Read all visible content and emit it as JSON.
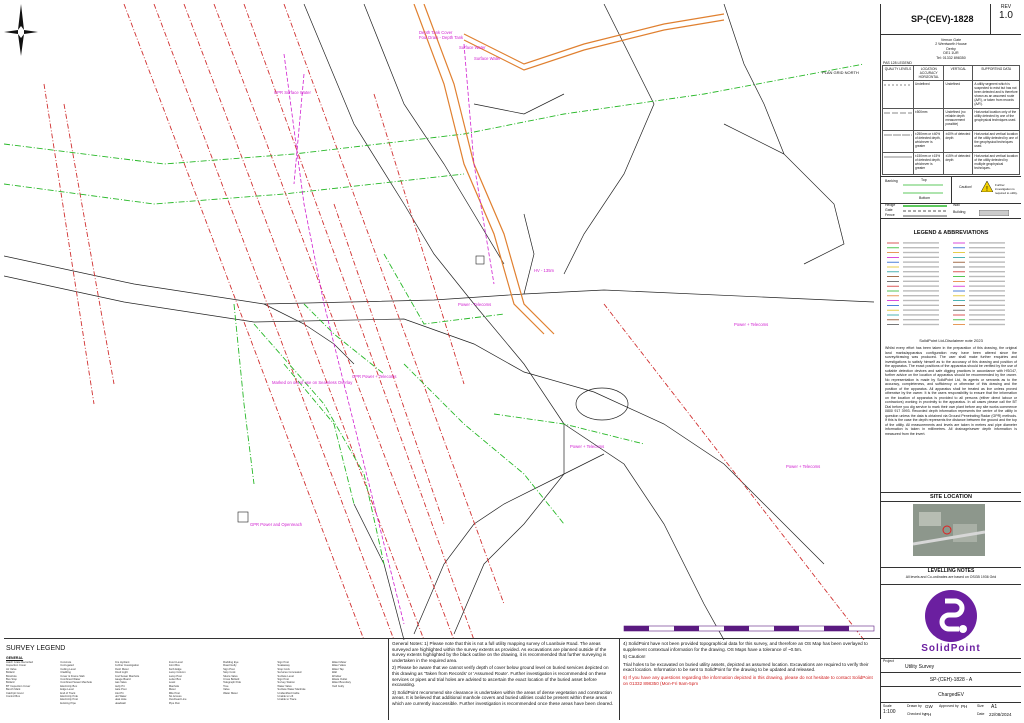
{
  "title_block": {
    "drawing_number": "SP-(CEV)-1828",
    "revision_label": "REV",
    "revision": "1.0",
    "address": [
      "Vernon Gate",
      "2 Wentworth House",
      "Derby",
      "DE1 1UR",
      "Tel: 01332 898350"
    ],
    "pas_title": "PAS 128 LEGEND",
    "quality_table": {
      "headers": [
        "QUALITY LEVELS",
        "LOCATION ACCURACY HORIZONTAL",
        "VERTICAL",
        "SUPPORTING DATA"
      ],
      "rows": [
        [
          "",
          "Undefined",
          "Undefined",
          "A utility segment which is suspected to exist but has not been detected and is therefore shown as an assumed route (A/R), or taken from records (A/R)."
        ],
        [
          "",
          "±500mm",
          "Undefined (no reliable depth measurement possible)",
          "Horizontal location only of the utility detected by one of the geophysical techniques used."
        ],
        [
          "",
          "±250mm or ±40% of detected depth, whichever is greater",
          "±40% of detected depth",
          "Horizontal and vertical location of the utility detected by one of the geophysical techniques used."
        ],
        [
          "",
          "±150mm or ±15% of detected depth, whichever is greater",
          "±15% of detected depth",
          "Horizontal and vertical location of the utility detected by multiple geophysical techniques."
        ]
      ]
    },
    "banking": {
      "label": "Banking",
      "top": "Top",
      "bottom": "Bottom",
      "caution": "Caution!",
      "caution_text": "Further investigation is required to utility."
    },
    "hedge": {
      "hedge": "Hedge",
      "wall": "Wall",
      "gate": "Gate",
      "building": "Building",
      "fence": "Fence"
    },
    "legend_title": "LEGEND & ABBREVIATIONS",
    "disclaimer_title": "SolidPoint Ltd-Disclaimer note 2023",
    "disclaimer": "Whilst every effort has been taken in the preparation of this drawing, the original land marks/apparatus configuration may have been altered since the survey/drawing was produced. The user shall make further enquiries and investigations to satisfy himself as to the accuracy of this drawing and position of the apparatus. The exact positions of the apparatus should be verified by the use of suitable detection devices and safe digging practices in accordance with HSG47, further advice on the location of apparatus should be recommended by the owner. No representation is made by SolidPoint Ltd, its agents or servants as to the accuracy, completeness, and sufficiency or otherwise of this drawing and the position of the apparatus. All apparatus shall be treated as live unless proved otherwise by the owner. It is the users responsibility to ensure that the information on the location of apparatus is provided to all persons (either direct labour or contractors) working in proximity to the apparatus. In all cases please call the BT Dial before you dig service to mark their own plant before any site works commence 0800 917 3993. Recorded depth information represents the centre of the utility in question unless the data is obtained via Ground Penetrating Radar (GPR) methods. If this is the case the depth represents the distance between the ground and the top of the utility. All measurements and levels are taken in metres and pipe diameter information is taken in millimetres. All drainage/sewer depth information is measured from the invert.",
    "site_location": "SITE LOCATION",
    "levelling_notes": "LEVELLING NOTES",
    "levelling_text": "All levels and Co-ordinates are based on OSGB 1936 Grid",
    "logo_text": "SolidPoint",
    "project_label": "Project",
    "project_name": "Utility Survey",
    "drawing_title": "SP-(CEH)-1828 - A",
    "client": "ChargedEV",
    "meta": {
      "scale_label": "Scale",
      "scale": "1:100",
      "drawn_label": "Drawn by",
      "drawn": "GW",
      "checked_label": "Checked by",
      "checked": "PH",
      "approved_label": "Approved by",
      "approved": "PH",
      "size_label": "Size",
      "size": "A1",
      "date_label": "Date",
      "date": "22/08/2024"
    }
  },
  "map": {
    "north_label": "PLAN GRID NORTH",
    "labels": [
      {
        "text": "Depth Tank Cover",
        "color": "#d020d0"
      },
      {
        "text": "Foul Drain - Depth Tank",
        "color": "#d020d0"
      },
      {
        "text": "Surface Water",
        "color": "#d020d0"
      },
      {
        "text": "Surface Water",
        "color": "#d020d0"
      },
      {
        "text": "GPR Surface Water",
        "color": "#d020d0"
      },
      {
        "text": "HV - 135m",
        "color": "#d020d0"
      },
      {
        "text": "Power - Telecoms",
        "color": "#d020d0"
      },
      {
        "text": "Power + Telecoms",
        "color": "#d020d0"
      },
      {
        "text": "Power + Telecoms",
        "color": "#d020d0"
      },
      {
        "text": "Power + Telecoms",
        "color": "#d020d0"
      },
      {
        "text": "Marked on out of use on Seamless Overlay",
        "color": "#d020d0"
      },
      {
        "text": "GPR Power and Openreach",
        "color": "#d020d0"
      },
      {
        "text": "GPR Power + Telecoms",
        "color": "#d020d0"
      }
    ]
  },
  "bottom": {
    "survey_legend": "SURVEY LEGEND",
    "general": "GENERAL",
    "abbr_columns": [
      [
        "Hatch Grate Recorded",
        "Inspection Cover",
        "Air Valve",
        "Bollard",
        "Borehole",
        "Bus Stop",
        "Bollard",
        "BT Inspection Cover",
        "Bench Mark",
        "Catchpit Cover",
        "Control Box"
      ],
      [
        "Concrete",
        "Corrugated",
        "Ceiling Level",
        "Cladding",
        "Cover & Frame Slab",
        "Combined Water",
        "Combined Sewer Manhole",
        "Electricity Box",
        "Edge Level",
        "End of Track",
        "Electricity Pole",
        "Electricity Post",
        "Existing Pipe"
      ],
      [
        "Fire Hydrant",
        "Further Investigation",
        "Flush Meter",
        "Flood Light",
        "Foul Sewer Manhole",
        "Gauge Board",
        "Gas Valve",
        "Gully Pit",
        "Gate Post",
        "Inlet Pit",
        "Hot Water",
        "Heat Hole",
        "Headwall"
      ],
      [
        "Invert Level",
        "Joint Box",
        "Kerb Edge",
        "Lamp Column",
        "Lamp Post",
        "Letter Box",
        "Level",
        "Manhole",
        "Meter",
        "Mile Post",
        "No Access",
        "Overhead Line",
        "Pipe Run"
      ],
      [
        "Rodding Eye",
        "Road Gully",
        "Sign Post",
        "Stop Cock",
        "Sluice Valve",
        "Cross Bollard",
        "Telegraph Pole",
        "Tree",
        "Valve",
        "Water Meter"
      ],
      [
        "Sign Post",
        "Soakaway",
        "Stop Cock",
        "Services Concealed",
        "Surface Level",
        "Sign Post",
        "Survey Station",
        "Water Valve",
        "Surface Water Manhole",
        "Unidentified Cable",
        "Unable to Lift",
        "Unable to Trace"
      ],
      [
        "Water Meter",
        "Water Valve",
        "Water Tap",
        "Wall",
        "Window",
        "Waste Outlet",
        "Water Boundary",
        "Yard Gully"
      ]
    ],
    "notes_left": [
      "General Notes: 1) Please note that this is not a full utility mapping survey of Loanbuie Road. The areas surveyed are highlighted within the survey extents as provided. As excavations are planned outside of the survey extents highlighted by the black outline on the drawing, it is recommended that further surveying is undertaken in the required area.",
      "2) Please be aware that we cannot verify depth of cover below ground level on buried services depicted on this drawing as 'Taken from Records' or 'Assumed Route'. Further investigation is recommended on these services or pipes and trial holes are advised to ascertain the exact location of the buried asset before excavating.",
      "3) SolidPoint recommend site clearance is undertaken within the areas of dense vegetation and construction areas. It is believed that additional manhole covers and buried utilities could be present within these areas which are currently inaccessible. Further investigation is recommended once these areas have been cleared."
    ],
    "notes_right": [
      "4) SolidPoint have not been provided topographical data for this survey, and therefore an OS Map has been overlayed to supplement contextual information for the drawing. OS Maps have a tolerance of ~0.5m.",
      "5) Caution!",
      "Trial holes to be excavated on buried utility assets, depicted as assumed location. Excavations are required to verify their exact location. Information to be sent to SolidPoint for the drawing to be updated and released."
    ],
    "notes_red": "6) If you have any questions regarding the information depicted in this drawing, please do not hesitate to contact SolidPoint on 01332 898350 (Mon-Fri 9am-5pm"
  },
  "colors": {
    "brand": "#6b1fa0",
    "power": "#d03030",
    "telecom": "#28b828",
    "gas": "#e07820",
    "label": "#d020d0"
  }
}
